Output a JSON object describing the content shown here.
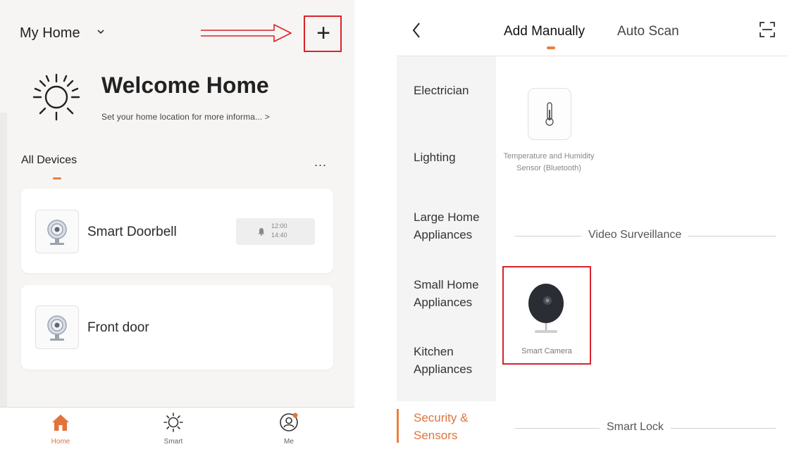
{
  "home_screen": {
    "home_name": "My Home",
    "welcome": "Welcome Home",
    "location_prompt": "Set your home location for more informa... >",
    "section_title": "All Devices",
    "more_label": "...",
    "devices": [
      {
        "name": "Smart Doorbell",
        "schedule": "12:00\n14:40"
      },
      {
        "name": "Front door"
      }
    ],
    "tabs": [
      {
        "label": "Home"
      },
      {
        "label": "Smart"
      },
      {
        "label": "Me"
      }
    ],
    "accent_color": "#e8803f",
    "highlight_color": "#d8232a"
  },
  "add_device_screen": {
    "tabs": [
      {
        "label": "Add Manually"
      },
      {
        "label": "Auto Scan"
      }
    ],
    "categories": [
      {
        "label": "Electrician"
      },
      {
        "label": "Lighting"
      },
      {
        "label": "Large Home Appliances"
      },
      {
        "label": "Small Home Appliances"
      },
      {
        "label": "Kitchen Appliances"
      },
      {
        "label": "Security & Sensors"
      }
    ],
    "sensor_item": "Temperature and Humidity Sensor (Bluetooth)",
    "section_video": "Video Surveillance",
    "camera_item": "Smart Camera",
    "section_lock": "Smart Lock"
  }
}
